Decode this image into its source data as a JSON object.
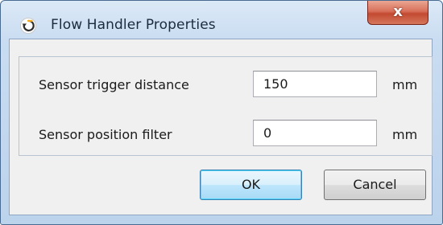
{
  "window": {
    "title": "Flow Handler Properties",
    "app_icon": "refresh-arrow-icon",
    "close_label": "x"
  },
  "fields": [
    {
      "label": "Sensor trigger distance",
      "value": "150",
      "unit": "mm"
    },
    {
      "label": "Sensor position filter",
      "value": "0",
      "unit": "mm"
    }
  ],
  "buttons": {
    "ok_label": "OK",
    "cancel_label": "Cancel"
  },
  "colors": {
    "titlebar": "#c9dcf1",
    "close_button": "#c24a31",
    "default_button_border": "#3c7fb1"
  }
}
